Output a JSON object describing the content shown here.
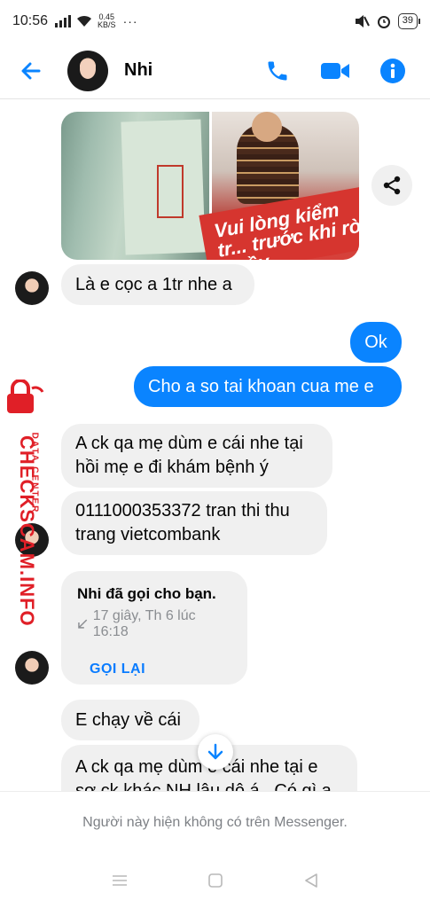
{
  "status_bar": {
    "time": "10:56",
    "speed_value": "0.45",
    "speed_unit": "KB/S",
    "battery": "39"
  },
  "header": {
    "contact_name": "Nhi",
    "icons": [
      "back-arrow-icon",
      "phone-icon",
      "video-icon",
      "info-icon"
    ],
    "accent_color": "#0a84ff"
  },
  "messages": [
    {
      "from": "contact",
      "text": "Là e cọc a 1tr nhe a"
    },
    {
      "from": "me",
      "text": "Ok"
    },
    {
      "from": "me",
      "text": "Cho a so tai khoan cua me e"
    },
    {
      "from": "contact",
      "text": "A ck qa mẹ dùm e cái nhe tại hồi mẹ e đi khám bệnh ý"
    },
    {
      "from": "contact",
      "text": "0111000353372 tran thi thu trang vietcombank"
    },
    {
      "from": "contact",
      "text": "E chạy về cái"
    },
    {
      "from": "contact",
      "text": "A ck qa mẹ dùm e cái nhe tại e sợ ck khác NH lâu dô á . Có gì a"
    }
  ],
  "photos": {
    "banner_text": "Vui lòng kiểm tr... trước khi rời Quầy..."
  },
  "call_card": {
    "title": "Nhi đã gọi cho bạn.",
    "subtitle": "17 giây, Th 6 lúc 16:18",
    "button": "GỌI LẠI"
  },
  "watermark": {
    "main": "CHECKSCAM.INFO",
    "sub": "DATA CENTER"
  },
  "footer": {
    "unavailable_text": "Người này hiện không có trên Messenger."
  }
}
